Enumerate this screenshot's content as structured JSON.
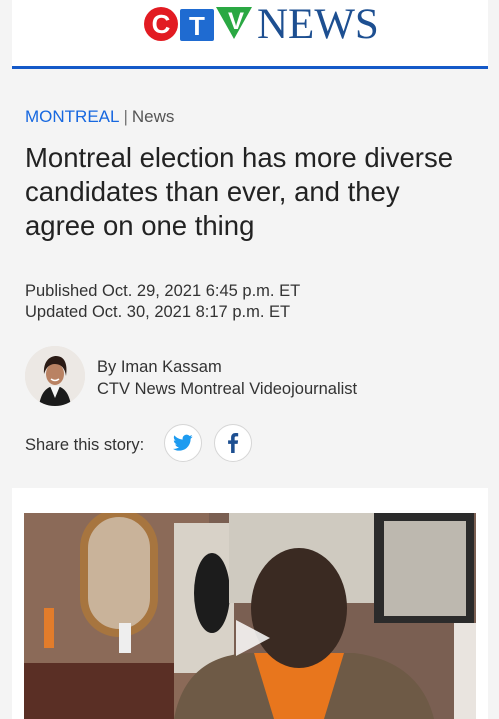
{
  "header": {
    "logo_letters": [
      "C",
      "T",
      "V"
    ],
    "logo_word": "NEWS"
  },
  "article": {
    "section": "MONTREAL",
    "separator": "|",
    "category": "News",
    "headline": "Montreal election has more diverse candidates than ever, and they agree on one thing",
    "published": "Published Oct. 29, 2021 6:45 p.m. ET",
    "updated": "Updated Oct. 30, 2021 8:17 p.m. ET",
    "author": "By Iman Kassam",
    "author_role": "CTV News Montreal Videojournalist"
  },
  "share": {
    "label": "Share this story:"
  },
  "colors": {
    "brand_blue": "#1459c8",
    "section_blue": "#1768e0",
    "twitter": "#1d9bf0",
    "facebook": "#1d4f91",
    "ctv_red": "#e21b22",
    "ctv_blue": "#1f6bd1",
    "ctv_green": "#2aa843"
  },
  "icons": {
    "twitter": "twitter-icon",
    "facebook": "facebook-icon",
    "play": "play-icon"
  }
}
